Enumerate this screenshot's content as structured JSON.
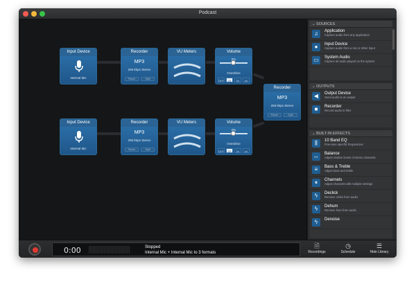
{
  "window": {
    "title": "Podcast"
  },
  "chain1": {
    "input": {
      "title": "Input Device",
      "name": "Internal Mic"
    },
    "recorder": {
      "title": "Recorder",
      "format": "MP3",
      "quality": "256 kbps Stereo",
      "pause": "Pause",
      "split": "Split"
    },
    "vu": {
      "title": "VU Meters"
    },
    "volume": {
      "title": "Volume",
      "value": "0%",
      "mode": "Overdrive",
      "options": [
        "OFF",
        "2X",
        "3X",
        "4X"
      ]
    }
  },
  "chain2": {
    "input": {
      "title": "Input Device",
      "name": "Internal Mic"
    },
    "recorder": {
      "title": "Recorder",
      "format": "MP3",
      "quality": "256 kbps Stereo",
      "pause": "Pause",
      "split": "Split"
    },
    "vu": {
      "title": "VU Meters"
    },
    "volume": {
      "title": "Volume",
      "value": "0%",
      "mode": "Overdrive",
      "options": [
        "OFF",
        "2X",
        "3X",
        "4X"
      ]
    }
  },
  "merge_recorder": {
    "title": "Recorder",
    "format": "MP3",
    "quality": "256 kbps Stereo",
    "pause": "Pause",
    "split": "Split"
  },
  "sidebar": {
    "sources": {
      "header": "SOURCES",
      "items": [
        {
          "title": "Application",
          "desc": "Capture audio from any application",
          "icon": "microphone-icon"
        },
        {
          "title": "Input Device",
          "desc": "Capture audio from a mic or other input",
          "icon": "mic-input-icon"
        },
        {
          "title": "System Audio",
          "desc": "Capture all audio played on the system",
          "icon": "monitor-icon"
        }
      ]
    },
    "outputs": {
      "header": "OUTPUTS",
      "items": [
        {
          "title": "Output Device",
          "desc": "Send audio to an output",
          "icon": "speaker-icon"
        },
        {
          "title": "Recorder",
          "desc": "Record audio to files",
          "icon": "record-icon"
        }
      ]
    },
    "effects": {
      "header": "BUILT-IN EFFECTS",
      "items": [
        {
          "title": "10 Band EQ",
          "desc": "Fine-tune specific frequencies",
          "icon": "eq-icon"
        },
        {
          "title": "Balance",
          "desc": "Adjust relative levels of stereo channels",
          "icon": "balance-icon"
        },
        {
          "title": "Bass & Treble",
          "desc": "Adjust bass and treble",
          "icon": "sliders-icon"
        },
        {
          "title": "Channels",
          "desc": "Adjust channels with multiple settings",
          "icon": "channels-icon"
        },
        {
          "title": "Declick",
          "desc": "Remove clicks from audio",
          "icon": "lightning-icon"
        },
        {
          "title": "Dehum",
          "desc": "Remove hum from audio",
          "icon": "lightning-icon"
        },
        {
          "title": "Denoise",
          "desc": "",
          "icon": "lightning-icon"
        }
      ]
    }
  },
  "bottom": {
    "time": "0:00",
    "status": "Stopped",
    "summary": "Internal Mic + Internal Mic to 3 formats",
    "buttons": {
      "recordings": "Recordings",
      "schedule": "Schedule",
      "library": "Hide Library"
    }
  }
}
